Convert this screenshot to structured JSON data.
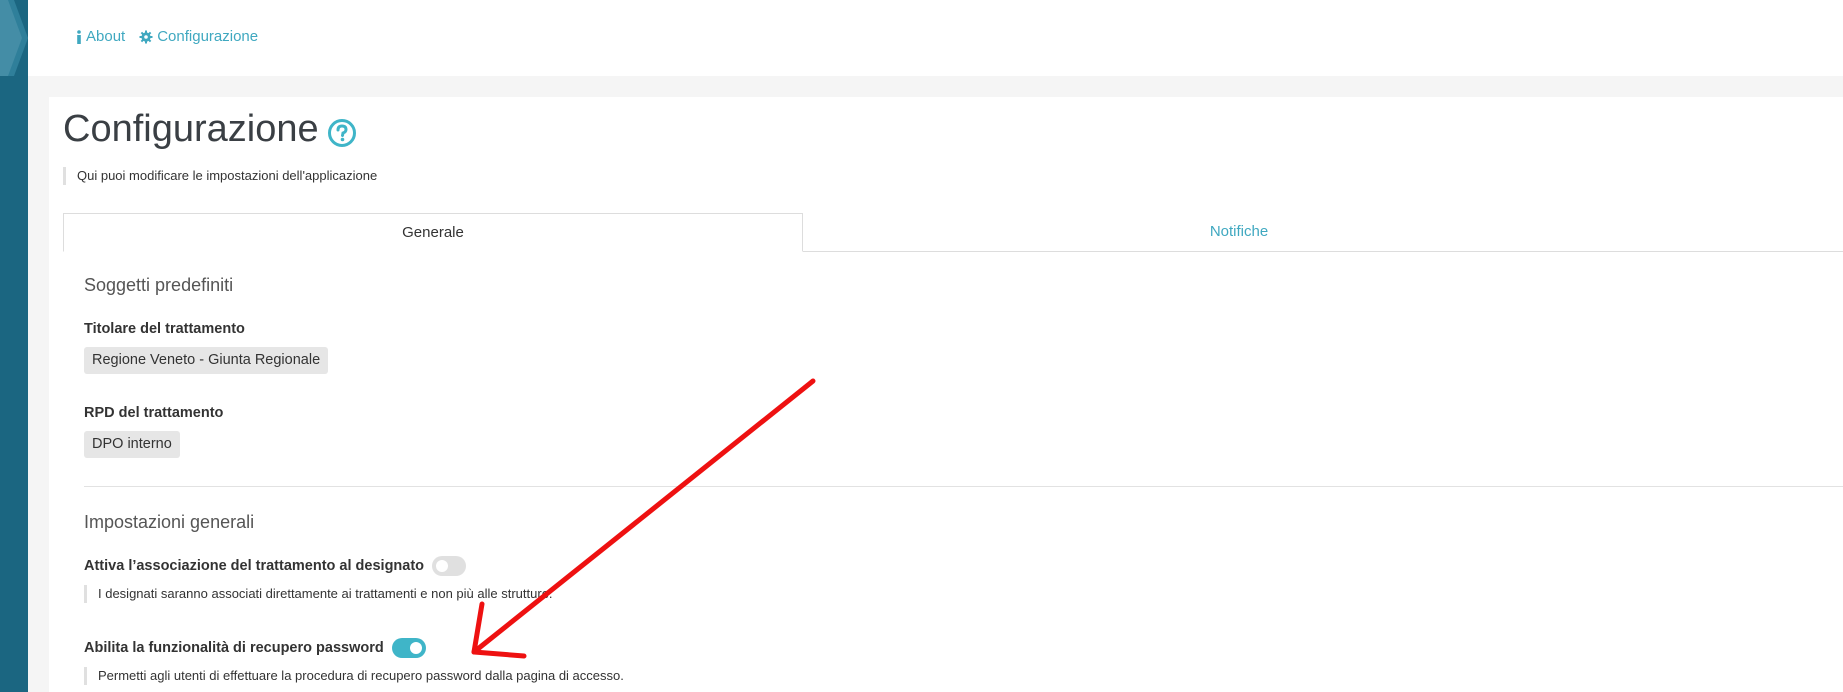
{
  "nav": {
    "about_label": "About",
    "about_icon": "info-icon",
    "config_label": "Configurazione",
    "config_icon": "gear-icon"
  },
  "page": {
    "title": "Configurazione",
    "help_icon": "question-circle-icon",
    "subtitle": "Qui puoi modificare le impostazioni dell'applicazione"
  },
  "tabs": [
    {
      "label": "Generale",
      "active": true
    },
    {
      "label": "Notifiche",
      "active": false
    }
  ],
  "sections": {
    "predefiniti": {
      "title": "Soggetti predefiniti",
      "titolare_label": "Titolare del trattamento",
      "titolare_value": "Regione Veneto - Giunta Regionale",
      "rpd_label": "RPD del trattamento",
      "rpd_value": "DPO interno"
    },
    "generali": {
      "title": "Impostazioni generali",
      "associazione_label": "Attiva l’associazione del trattamento al designato",
      "associazione_enabled": false,
      "associazione_help": "I designati saranno associati direttamente ai trattamenti e non più alle strutture.",
      "recupero_label": "Abilita la funzionalità di recupero password",
      "recupero_enabled": true,
      "recupero_help": "Permetti agli utenti di effettuare la procedura di recupero password dalla pagina di accesso."
    }
  },
  "colors": {
    "accent": "#3fa8c0",
    "sidebar": "#1b6681",
    "toggle_on": "#3fb5c8",
    "annotation_arrow": "#ee1111"
  }
}
